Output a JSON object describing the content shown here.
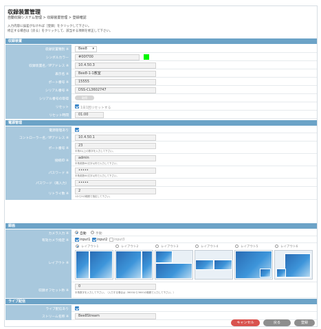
{
  "header": {
    "title": "収録装置管理",
    "breadcrumb": "自動収録システム管理 > 収録装置管理 > 登録確認",
    "intro_line1": "入力内容に誤差がなければ［登録］をクリックして下さい。",
    "intro_line2": "修正する場合は［戻る］をクリックして、該当する項目を修正して下さい。"
  },
  "sections": {
    "device": "収録装置",
    "power": "電源管理",
    "recording": "録画",
    "live": "ライブ配信"
  },
  "device": {
    "type_label": "収録装置種別 ※",
    "type_value": "Bee8",
    "color_label": "シンボルカラー",
    "color_value": "#00f700",
    "color_hex": "#00f700",
    "ip_label": "収録装置名／IPアドレス ※",
    "ip_value": "10.4.50.3",
    "name_label": "表示名 ※",
    "name_value": "Bee8-1-1教室",
    "port_label": "ポート番号 ※",
    "port_value": "15555",
    "serial_label": "シリアル番号 ※",
    "serial_value": "DSS-CL3602747",
    "serial_id_label": "シリアル番号の取得",
    "serial_id_button": "取得",
    "reset_label": "リセット",
    "reset_text": "1日1回リセットする",
    "reset_time_label": "リセット時間",
    "reset_time_value": "01:00"
  },
  "power": {
    "enable_label": "電源管理あり",
    "ctrl_label": "コントローラー名／IPアドレス ※",
    "ctrl_value": "10.4.50.1",
    "port_label": "ポート番号 ※",
    "port_value": "23",
    "port_hint": "半角0以上の数字を入力して下さい。",
    "login_label": "接続ID ※",
    "login_value": "admin",
    "login_hint": "半角英数64文字以内で入力して下さい。",
    "password_label": "パスワード ※",
    "password_value": "•••••",
    "password_hint": "半角英数64文字以内で入力して下さい。",
    "password2_label": "パスワード（再入力）",
    "password2_value": "•••••",
    "retry_label": "リトライ数 ※",
    "retry_value": "2",
    "retry_hint": "1から5の範囲で指定して下さい。"
  },
  "recording": {
    "camera_label": "カメラ入力 ※",
    "camera_auto": "自動",
    "camera_manual": "手動",
    "valid_label": "有効カメラ指定 ※",
    "input1": "input1",
    "input2": "input2",
    "input3": "input3",
    "layout_label": "レイアウト ※",
    "layouts": [
      "レイアウト1",
      "レイアウト2",
      "レイアウト3",
      "レイアウト4",
      "レイアウト5",
      "レイアウト6"
    ],
    "offset_label": "収録オフセット秒 ※",
    "offset_value": "0",
    "offset_hint": "半角数字を入力して下さい。（入力する場合は -3600から3600の範囲で入力して下さい。）"
  },
  "live": {
    "enable_label": "ライブ配信あり",
    "stream_label": "ストリーム名称 ※",
    "stream_value": "Bee8Stream"
  },
  "buttons": {
    "cancel": "キャンセル",
    "back": "戻る",
    "register": "登録"
  },
  "colors": {
    "section_bg": "#6ca3c7",
    "label_bg": "#a8c8dd",
    "cancel": "#d9534f",
    "grey_button": "#8e8e8e",
    "accent": "#3a86c8"
  }
}
